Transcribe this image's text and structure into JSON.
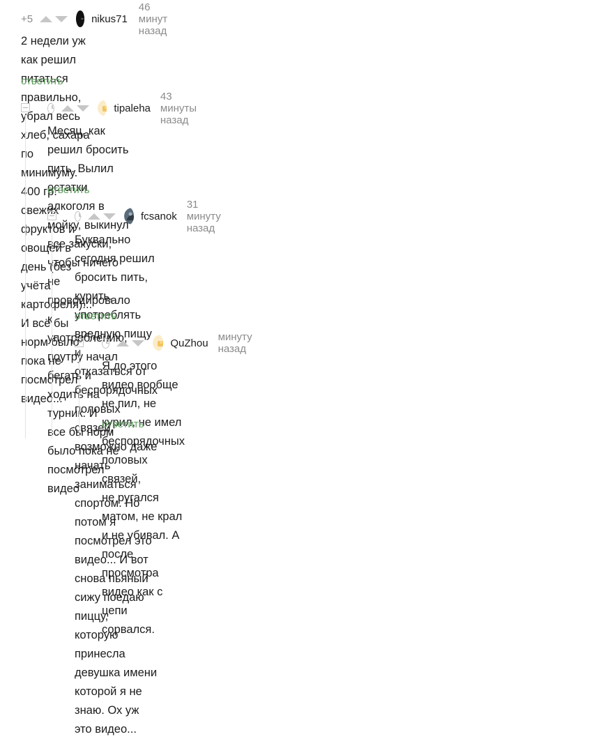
{
  "comments": [
    {
      "rating": "+5",
      "username": "nikus71",
      "time": "46 минут назад",
      "text": "2 недели уж как решил питаться правильно, убрал весь хлеб, сахара по минимуму. 400 гр. свежих\nфруктов и овощей в день (без учёта картофеля)... И всё бы норм было пока не посмотрел видео...",
      "reply": "ответить"
    },
    {
      "username": "tipaleha",
      "time": "43 минуты назад",
      "text": "Месяц, как решил бросить пить. Вылил остатки алкоголя в мойку, выкинул все закуски,\nчтобы ничего не провоцировало к употреблению, поутру начал бегать и ходить на турник. И\nвсе бы норм было пока не посмотрел видео",
      "reply": "ответить"
    },
    {
      "username": "fcsanok",
      "time": "31 минуту назад",
      "text": "Буквально сегодня решил бросить пить, курить, употреблять вредную пищу и\nотказаться от беспорядочных половых связей, возможно даже начать заниматься\nспортом. Но потом я посмотрел это видео... И вот снова пьяный сижу поедаю пиццу,\nкоторую принесла девушка имени которой я не знаю. Ох уж это видео...",
      "reply": "ответить"
    },
    {
      "username": "QuZhou",
      "time": "минуту назад",
      "text": "Я до этого видео вообще не пил, не курил, не имел беспорядочных половых связей,\nне ругался матом, не крал и не убивал. А после просмотра видео как с цепи\nсорвался.",
      "reply": "ответить"
    }
  ],
  "colors": {
    "reply_link": "#5fa05f",
    "meta_text": "#8b8b8b",
    "icon_gray": "#c6c6c6"
  },
  "icons": [
    "vote-up-icon",
    "vote-down-icon",
    "clock-icon",
    "collapse-icon",
    "avatar"
  ]
}
